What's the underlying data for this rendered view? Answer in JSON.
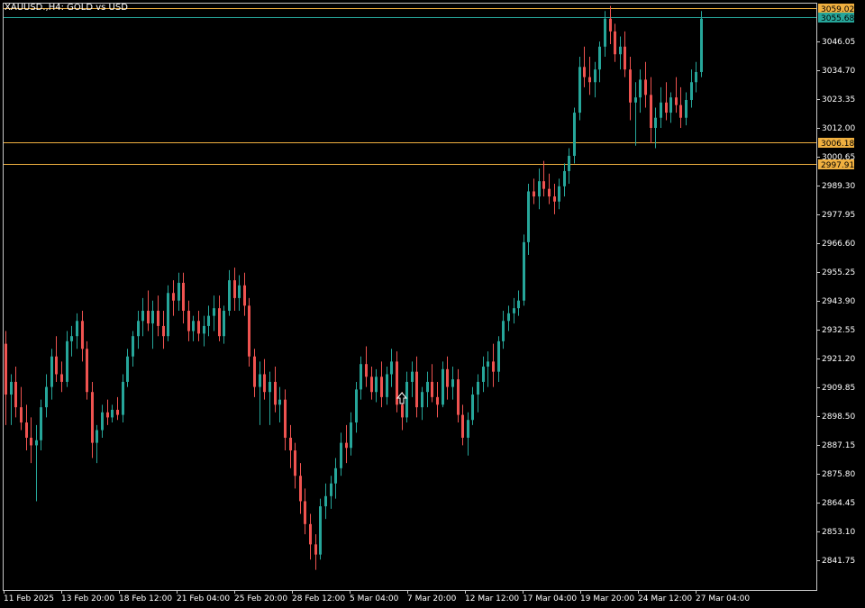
{
  "window": {
    "title": "XAUUSD.,H4: GOLD vs USD"
  },
  "colors": {
    "background": "#000000",
    "up": "#26a69a",
    "down": "#ef5350",
    "frame": "#ffffff",
    "hline": "#f0b040",
    "price_tag_up": "#26a69a"
  },
  "chart_data": {
    "type": "candlestick",
    "symbol": "XAUUSD.",
    "timeframe": "H4",
    "title": "XAUUSD.,H4: GOLD vs USD",
    "ylim": [
      2830.0,
      3063.0
    ],
    "y_ticks": [
      "3046.05",
      "3034.70",
      "3023.35",
      "3012.00",
      "3000.65",
      "2989.30",
      "2977.95",
      "2966.60",
      "2955.25",
      "2943.90",
      "2932.55",
      "2921.20",
      "2909.85",
      "2898.50",
      "2887.15",
      "2875.80",
      "2864.45",
      "2853.10",
      "2841.75"
    ],
    "x_ticks": [
      "11 Feb 2025",
      "13 Feb 20:00",
      "18 Feb 12:00",
      "21 Feb 04:00",
      "25 Feb 20:00",
      "28 Feb 12:00",
      "5 Mar 04:00",
      "7 Mar 20:00",
      "12 Mar 12:00",
      "17 Mar 04:00",
      "19 Mar 20:00",
      "24 Mar 12:00",
      "27 Mar 04:00"
    ],
    "horizontal_lines": [
      {
        "price": 3059.02,
        "label": "3059.02",
        "color": "#f0b040"
      },
      {
        "price": 3006.18,
        "label": "3006.18",
        "color": "#f0b040"
      },
      {
        "price": 2997.91,
        "label": "2997.91",
        "color": "#f0b040"
      }
    ],
    "current_price": {
      "price": 3055.68,
      "label": "3055.68"
    },
    "grid": false,
    "candles": [
      [
        2927,
        2932,
        2895,
        2907
      ],
      [
        2907,
        2915,
        2895,
        2912
      ],
      [
        2912,
        2918,
        2898,
        2902
      ],
      [
        2902,
        2910,
        2893,
        2896
      ],
      [
        2896,
        2903,
        2885,
        2890
      ],
      [
        2890,
        2898,
        2880,
        2887
      ],
      [
        2887,
        2895,
        2865,
        2889
      ],
      [
        2889,
        2905,
        2885,
        2902
      ],
      [
        2902,
        2915,
        2898,
        2910
      ],
      [
        2910,
        2925,
        2905,
        2922
      ],
      [
        2922,
        2930,
        2912,
        2915
      ],
      [
        2915,
        2920,
        2908,
        2912
      ],
      [
        2912,
        2932,
        2910,
        2928
      ],
      [
        2928,
        2934,
        2922,
        2930
      ],
      [
        2930,
        2939,
        2925,
        2936
      ],
      [
        2936,
        2940,
        2920,
        2925
      ],
      [
        2925,
        2928,
        2905,
        2908
      ],
      [
        2908,
        2912,
        2882,
        2888
      ],
      [
        2888,
        2895,
        2880,
        2893
      ],
      [
        2893,
        2903,
        2890,
        2900
      ],
      [
        2900,
        2905,
        2895,
        2898
      ],
      [
        2898,
        2903,
        2896,
        2901
      ],
      [
        2901,
        2906,
        2897,
        2899
      ],
      [
        2899,
        2915,
        2896,
        2912
      ],
      [
        2912,
        2925,
        2910,
        2922
      ],
      [
        2922,
        2932,
        2918,
        2930
      ],
      [
        2930,
        2940,
        2925,
        2936
      ],
      [
        2936,
        2945,
        2930,
        2940
      ],
      [
        2940,
        2948,
        2932,
        2935
      ],
      [
        2935,
        2944,
        2925,
        2940
      ],
      [
        2940,
        2946,
        2930,
        2934
      ],
      [
        2934,
        2940,
        2925,
        2930
      ],
      [
        2930,
        2950,
        2928,
        2947
      ],
      [
        2947,
        2952,
        2938,
        2944
      ],
      [
        2944,
        2955,
        2940,
        2951
      ],
      [
        2951,
        2955,
        2935,
        2940
      ],
      [
        2940,
        2944,
        2928,
        2932
      ],
      [
        2932,
        2938,
        2928,
        2936
      ],
      [
        2936,
        2940,
        2928,
        2931
      ],
      [
        2931,
        2938,
        2926,
        2934
      ],
      [
        2934,
        2942,
        2930,
        2938
      ],
      [
        2938,
        2946,
        2932,
        2941
      ],
      [
        2941,
        2946,
        2928,
        2930
      ],
      [
        2930,
        2942,
        2927,
        2940
      ],
      [
        2940,
        2956,
        2938,
        2952
      ],
      [
        2952,
        2957,
        2940,
        2945
      ],
      [
        2945,
        2954,
        2940,
        2950
      ],
      [
        2950,
        2955,
        2938,
        2942
      ],
      [
        2942,
        2945,
        2918,
        2922
      ],
      [
        2922,
        2925,
        2906,
        2910
      ],
      [
        2910,
        2920,
        2895,
        2915
      ],
      [
        2915,
        2921,
        2905,
        2908
      ],
      [
        2908,
        2916,
        2895,
        2912
      ],
      [
        2912,
        2918,
        2900,
        2903
      ],
      [
        2903,
        2910,
        2896,
        2905
      ],
      [
        2905,
        2909,
        2885,
        2890
      ],
      [
        2890,
        2895,
        2878,
        2885
      ],
      [
        2885,
        2888,
        2870,
        2875
      ],
      [
        2875,
        2880,
        2860,
        2865
      ],
      [
        2865,
        2870,
        2852,
        2856
      ],
      [
        2856,
        2860,
        2842,
        2848
      ],
      [
        2848,
        2852,
        2838,
        2844
      ],
      [
        2844,
        2866,
        2842,
        2863
      ],
      [
        2863,
        2872,
        2858,
        2867
      ],
      [
        2867,
        2875,
        2862,
        2872
      ],
      [
        2872,
        2882,
        2866,
        2878
      ],
      [
        2878,
        2892,
        2875,
        2888
      ],
      [
        2888,
        2895,
        2880,
        2886
      ],
      [
        2886,
        2900,
        2883,
        2896
      ],
      [
        2896,
        2912,
        2892,
        2909
      ],
      [
        2909,
        2922,
        2905,
        2919
      ],
      [
        2919,
        2926,
        2910,
        2914
      ],
      [
        2914,
        2918,
        2905,
        2908
      ],
      [
        2908,
        2917,
        2904,
        2914
      ],
      [
        2914,
        2920,
        2902,
        2906
      ],
      [
        2906,
        2918,
        2903,
        2915
      ],
      [
        2915,
        2925,
        2910,
        2920
      ],
      [
        2920,
        2924,
        2900,
        2903
      ],
      [
        2903,
        2908,
        2893,
        2898
      ],
      [
        2898,
        2916,
        2896,
        2912
      ],
      [
        2912,
        2920,
        2906,
        2916
      ],
      [
        2916,
        2922,
        2898,
        2902
      ],
      [
        2902,
        2910,
        2897,
        2908
      ],
      [
        2908,
        2916,
        2902,
        2912
      ],
      [
        2912,
        2919,
        2904,
        2906
      ],
      [
        2906,
        2912,
        2898,
        2903
      ],
      [
        2903,
        2920,
        2902,
        2917
      ],
      [
        2917,
        2922,
        2905,
        2910
      ],
      [
        2910,
        2918,
        2905,
        2913
      ],
      [
        2913,
        2917,
        2896,
        2899
      ],
      [
        2899,
        2903,
        2887,
        2890
      ],
      [
        2890,
        2900,
        2883,
        2897
      ],
      [
        2897,
        2910,
        2895,
        2907
      ],
      [
        2907,
        2915,
        2900,
        2912
      ],
      [
        2912,
        2922,
        2908,
        2918
      ],
      [
        2918,
        2924,
        2910,
        2920
      ],
      [
        2920,
        2927,
        2910,
        2916
      ],
      [
        2916,
        2930,
        2912,
        2928
      ],
      [
        2928,
        2940,
        2925,
        2936
      ],
      [
        2936,
        2942,
        2932,
        2939
      ],
      [
        2939,
        2945,
        2935,
        2941
      ],
      [
        2941,
        2948,
        2938,
        2944
      ],
      [
        2944,
        2970,
        2942,
        2967
      ],
      [
        2967,
        2990,
        2962,
        2987
      ],
      [
        2987,
        2992,
        2982,
        2985
      ],
      [
        2985,
        2996,
        2980,
        2991
      ],
      [
        2991,
        2999,
        2985,
        2988
      ],
      [
        2988,
        2994,
        2982,
        2985
      ],
      [
        2985,
        2990,
        2978,
        2983
      ],
      [
        2983,
        2992,
        2980,
        2989
      ],
      [
        2989,
        2998,
        2985,
        2995
      ],
      [
        2995,
        3004,
        2990,
        3001
      ],
      [
        3001,
        3020,
        2998,
        3018
      ],
      [
        3018,
        3040,
        3015,
        3036
      ],
      [
        3036,
        3044,
        3028,
        3032
      ],
      [
        3032,
        3040,
        3025,
        3030
      ],
      [
        3030,
        3038,
        3024,
        3035
      ],
      [
        3035,
        3046,
        3030,
        3044
      ],
      [
        3044,
        3058,
        3040,
        3055
      ],
      [
        3055,
        3060,
        3045,
        3050
      ],
      [
        3050,
        3053,
        3038,
        3041
      ],
      [
        3041,
        3048,
        3035,
        3044
      ],
      [
        3044,
        3050,
        3032,
        3035
      ],
      [
        3035,
        3040,
        3015,
        3022
      ],
      [
        3022,
        3030,
        3005,
        3024
      ],
      [
        3024,
        3035,
        3018,
        3031
      ],
      [
        3031,
        3038,
        3020,
        3025
      ],
      [
        3025,
        3032,
        3006,
        3012
      ],
      [
        3012,
        3020,
        3004,
        3016
      ],
      [
        3016,
        3028,
        3012,
        3022
      ],
      [
        3022,
        3030,
        3015,
        3018
      ],
      [
        3018,
        3026,
        3014,
        3024
      ],
      [
        3024,
        3032,
        3018,
        3021
      ],
      [
        3021,
        3028,
        3012,
        3016
      ],
      [
        3016,
        3026,
        3013,
        3023
      ],
      [
        3023,
        3035,
        3020,
        3030
      ],
      [
        3030,
        3038,
        3026,
        3034
      ],
      [
        3034,
        3058,
        3032,
        3055
      ]
    ]
  }
}
